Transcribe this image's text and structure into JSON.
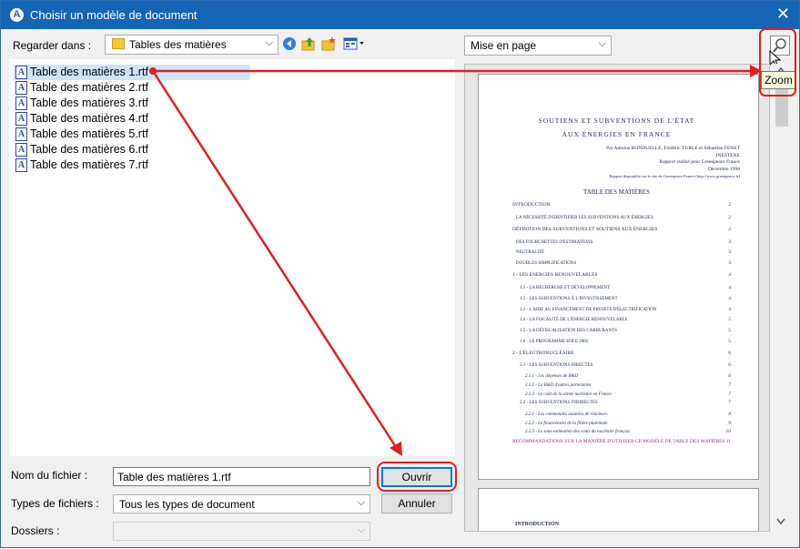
{
  "window": {
    "title": "Choisir un modèle de document",
    "close_glyph": "✕"
  },
  "look_in": {
    "label": "Regarder dans :",
    "value": "Tables des matières"
  },
  "view_dropdown": {
    "value": "Mise en page"
  },
  "files": [
    "Table des matières 1.rtf",
    "Table des matières 2.rtf",
    "Table des matières 3.rtf",
    "Table des matières 4.rtf",
    "Table des matières 5.rtf",
    "Table des matières 6.rtf",
    "Table des matières 7.rtf"
  ],
  "selected_index": 0,
  "filename": {
    "label": "Nom du fichier :",
    "value": "Table des matières 1.rtf"
  },
  "filetypes": {
    "label": "Types de fichiers :",
    "value": "Tous les types de document"
  },
  "folders": {
    "label": "Dossiers :",
    "value": ""
  },
  "buttons": {
    "open": "Ouvrir",
    "cancel": "Annuler"
  },
  "tooltip": "Zoom",
  "preview": {
    "title_line1": "SOUTIENS ET SUBVENTIONS DE L'ÉTAT",
    "title_line2": "AUX ÉNERGIES EN FRANCE",
    "authors": "Par Antoine BONDUELLE, Frédéric TURLE et Sébastien FENET",
    "org": "INESTENE",
    "report": "Rapport réalisé pour Greenpeace France",
    "date": "Décembre 1998",
    "url": "Rapport disponible sur le site de Greenpeace France (http://www.greenpeace.fr)",
    "toc_title": "TABLE DES MATIÈRES",
    "toc": [
      {
        "text": "INTRODUCTION",
        "page": "2"
      },
      {
        "text": "LA NÉCESSITÉ D'IDENTIFIER LES SUBVENTIONS AUX ÉNERGIES",
        "page": "2"
      },
      {
        "text": "DÉFINITION DES SUBVENTIONS ET SOUTIENS AUX ÉNERGIES",
        "page": "2"
      },
      {
        "text": "DES FOURCHETTES D'ESTIMATIONS",
        "page": "3"
      },
      {
        "text": "NEUTRALITÉ",
        "page": "3"
      },
      {
        "text": "DOUBLES SIMPLIFICATIONS",
        "page": "3"
      },
      {
        "text": "1 - LES ÉNERGIES RENOUVELABLES",
        "page": "4"
      },
      {
        "text": "1.1 - LA RECHERCHE ET DÉVELOPPEMENT",
        "page": "4"
      },
      {
        "text": "1.2 - LES SUBVENTIONS À L'INVESTISSEMENT",
        "page": "4"
      },
      {
        "text": "1.3 - L'AIDE AU FINANCEMENT DE PROJETS D'ÉLECTRIFICATION",
        "page": "4"
      },
      {
        "text": "1.4 - LA FISCALITÉ DE L'ÉNERGIE RENOUVELABLE",
        "page": "5"
      },
      {
        "text": "1.5 - LA DÉFISCALISATION DES CARBURANTS",
        "page": "5"
      },
      {
        "text": "1.6 - LE PROGRAMME EOLE 2005",
        "page": "5"
      },
      {
        "text": "2 - L'ÉLECTRONUCLÉAIRE",
        "page": "6"
      },
      {
        "text": "2.1 - LES SUBVENTIONS DIRECTES",
        "page": "6"
      },
      {
        "text": "2.1.1 - Les dépenses de R&D",
        "page": "6"
      },
      {
        "text": "2.1.2 - La R&D d'autres partenaires",
        "page": "7"
      },
      {
        "text": "2.1.3 - Le coût de la sûreté nucléaire en France",
        "page": "7"
      },
      {
        "text": "2.2 - LES SUBVENTIONS INDIRECTES",
        "page": "7"
      },
      {
        "text": "2.2.1 - Les commandes assurées de réacteurs",
        "page": "8"
      },
      {
        "text": "2.2.2 - Le financement de la filière plutonium",
        "page": "9"
      },
      {
        "text": "2.2.3 - Le sous-estimation des coûts du nucléaire français",
        "page": "10"
      },
      {
        "text": "RECOMMANDATIONS SUR LA MANIÈRE D'UTILISER CE MODÈLE DE TABLE DES MATIÈRES",
        "page": "11"
      }
    ],
    "page2_heading": "INTRODUCTION"
  }
}
